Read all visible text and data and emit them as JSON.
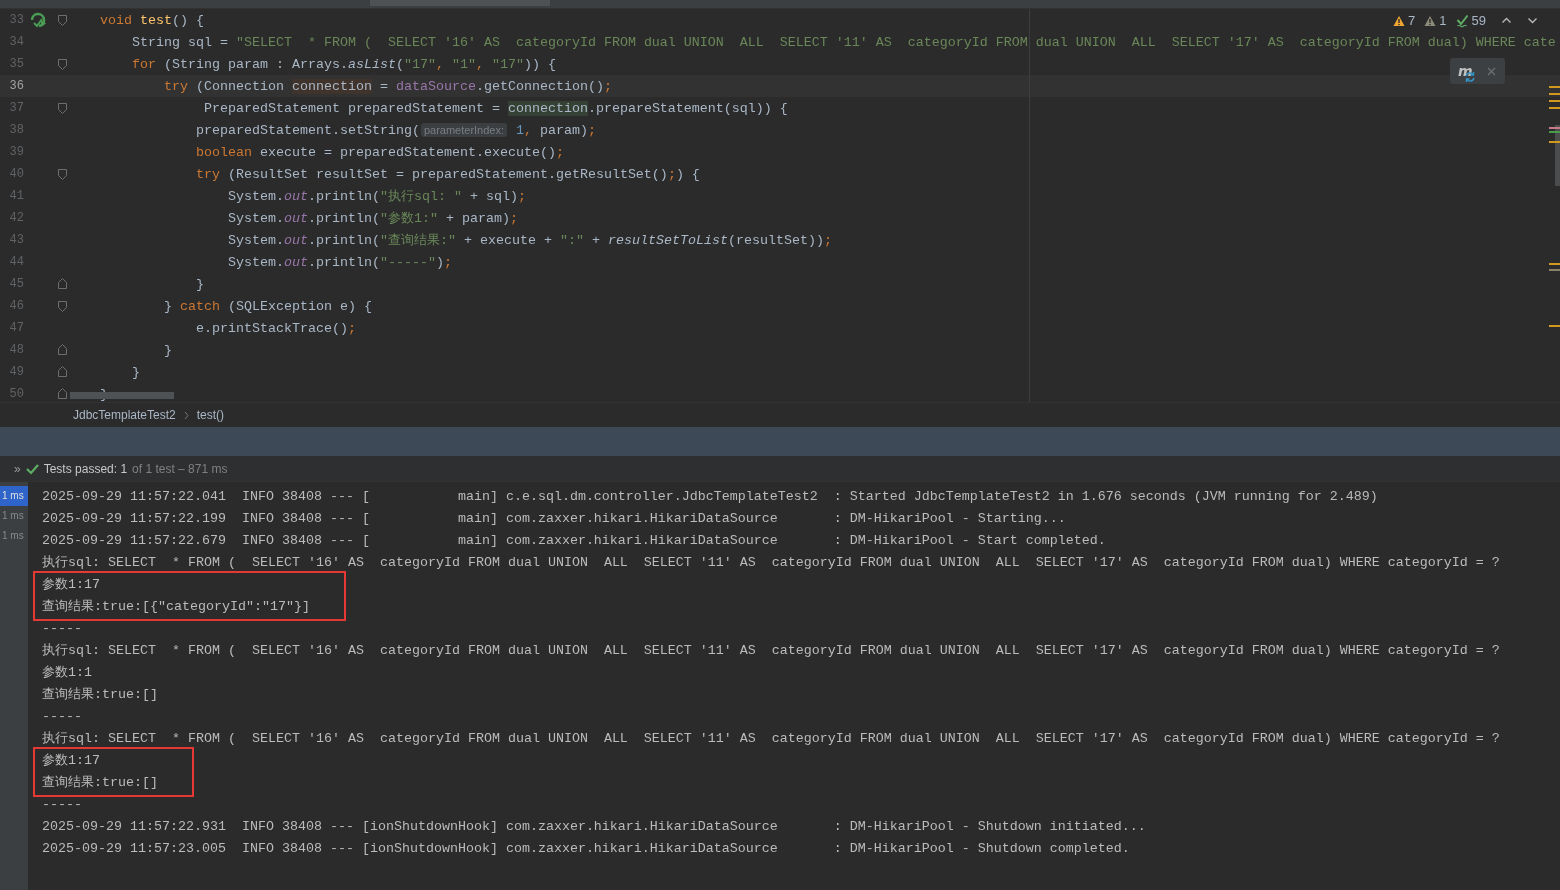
{
  "editor": {
    "inspections": [
      {
        "kind": "warning",
        "count": "7"
      },
      {
        "kind": "weak",
        "count": "1"
      },
      {
        "kind": "typo",
        "count": "59"
      }
    ],
    "popup": {
      "label": "m"
    },
    "lines": [
      {
        "number": "33",
        "current": false,
        "run": true,
        "fold_open": true,
        "fold_close": false,
        "tokens": [
          {
            "t": "    void",
            "kind": "kw"
          },
          {
            "t": " test",
            "kind": "fn"
          },
          {
            "t": "() {"
          }
        ]
      },
      {
        "number": "34",
        "current": false,
        "run": false,
        "fold_open": false,
        "fold_close": false,
        "tokens": [
          {
            "t": "        String sql = "
          },
          {
            "t": "\"SELECT  * FROM (  SELECT '16' AS  categoryId FROM dual UNION  ALL  SELECT '11' AS  categoryId FROM dual UNION  ALL  SELECT '17' AS  categoryId FROM dual) WHERE cate",
            "kind": "str"
          }
        ]
      },
      {
        "number": "35",
        "current": false,
        "run": false,
        "fold_open": true,
        "fold_close": false,
        "tokens": [
          {
            "t": "        for",
            "kind": "kw"
          },
          {
            "t": " (String param : Arrays."
          },
          {
            "t": "asList",
            "kind": "it"
          },
          {
            "t": "("
          },
          {
            "t": "\"17\"",
            "kind": "str"
          },
          {
            "t": ", ",
            "kind": "punct"
          },
          {
            "t": "\"1\"",
            "kind": "str"
          },
          {
            "t": ", ",
            "kind": "punct"
          },
          {
            "t": "\"17\"",
            "kind": "str"
          },
          {
            "t": ")) {"
          }
        ]
      },
      {
        "number": "36",
        "current": true,
        "run": false,
        "fold_open": false,
        "fold_close": false,
        "tokens": [
          {
            "t": "            try",
            "kind": "kw"
          },
          {
            "t": " (Connection "
          },
          {
            "t": "connection",
            "kind": "write"
          },
          {
            "t": " = "
          },
          {
            "t": "dataSource",
            "kind": "fld"
          },
          {
            "t": ".getConnection()"
          },
          {
            "t": ";",
            "kind": "punct"
          }
        ]
      },
      {
        "number": "37",
        "current": false,
        "run": false,
        "fold_open": true,
        "fold_close": false,
        "tokens": [
          {
            "t": "                 PreparedStatement preparedStatement = "
          },
          {
            "t": "connection",
            "kind": "read"
          },
          {
            "t": ".prepareStatement(sql)) {"
          }
        ]
      },
      {
        "number": "38",
        "current": false,
        "run": false,
        "fold_open": false,
        "fold_close": false,
        "tokens": [
          {
            "t": "                preparedStatement.setString("
          },
          {
            "t": "parameterIndex:",
            "kind": "hint"
          },
          {
            "t": " 1",
            "kind": "num"
          },
          {
            "t": ", ",
            "kind": "punct"
          },
          {
            "t": "param)"
          },
          {
            "t": ";",
            "kind": "punct"
          }
        ]
      },
      {
        "number": "39",
        "current": false,
        "run": false,
        "fold_open": false,
        "fold_close": false,
        "tokens": [
          {
            "t": "                boolean",
            "kind": "kw"
          },
          {
            "t": " execute = preparedStatement.execute()"
          },
          {
            "t": ";",
            "kind": "punct"
          }
        ]
      },
      {
        "number": "40",
        "current": false,
        "run": false,
        "fold_open": true,
        "fold_close": false,
        "tokens": [
          {
            "t": "                try",
            "kind": "kw"
          },
          {
            "t": " (ResultSet resultSet = preparedStatement.getResultSet()"
          },
          {
            "t": ";",
            "kind": "punct"
          },
          {
            "t": ") {"
          }
        ]
      },
      {
        "number": "41",
        "current": false,
        "run": false,
        "fold_open": false,
        "fold_close": false,
        "tokens": [
          {
            "t": "                    System."
          },
          {
            "t": "out",
            "kind": "sfld"
          },
          {
            "t": ".println("
          },
          {
            "t": "\"执行sql: \"",
            "kind": "str"
          },
          {
            "t": " + sql)"
          },
          {
            "t": ";",
            "kind": "punct"
          }
        ]
      },
      {
        "number": "42",
        "current": false,
        "run": false,
        "fold_open": false,
        "fold_close": false,
        "tokens": [
          {
            "t": "                    System."
          },
          {
            "t": "out",
            "kind": "sfld"
          },
          {
            "t": ".println("
          },
          {
            "t": "\"参数1:\"",
            "kind": "str"
          },
          {
            "t": " + param)"
          },
          {
            "t": ";",
            "kind": "punct"
          }
        ]
      },
      {
        "number": "43",
        "current": false,
        "run": false,
        "fold_open": false,
        "fold_close": false,
        "tokens": [
          {
            "t": "                    System."
          },
          {
            "t": "out",
            "kind": "sfld"
          },
          {
            "t": ".println("
          },
          {
            "t": "\"查询结果:\"",
            "kind": "str"
          },
          {
            "t": " + execute + "
          },
          {
            "t": "\":\"",
            "kind": "str"
          },
          {
            "t": " + "
          },
          {
            "t": "resultSetToList",
            "kind": "it"
          },
          {
            "t": "(resultSet))"
          },
          {
            "t": ";",
            "kind": "punct"
          }
        ]
      },
      {
        "number": "44",
        "current": false,
        "run": false,
        "fold_open": false,
        "fold_close": false,
        "tokens": [
          {
            "t": "                    System."
          },
          {
            "t": "out",
            "kind": "sfld"
          },
          {
            "t": ".println("
          },
          {
            "t": "\"-----\"",
            "kind": "str"
          },
          {
            "t": ")"
          },
          {
            "t": ";",
            "kind": "punct"
          }
        ]
      },
      {
        "number": "45",
        "current": false,
        "run": false,
        "fold_open": false,
        "fold_close": true,
        "tokens": [
          {
            "t": "                }"
          }
        ]
      },
      {
        "number": "46",
        "current": false,
        "run": false,
        "fold_open": true,
        "fold_close": false,
        "tokens": [
          {
            "t": "            } "
          },
          {
            "t": "catch",
            "kind": "kw"
          },
          {
            "t": " (SQLException e) {"
          }
        ]
      },
      {
        "number": "47",
        "current": false,
        "run": false,
        "fold_open": false,
        "fold_close": false,
        "tokens": [
          {
            "t": "                e.printStackTrace()"
          },
          {
            "t": ";",
            "kind": "punct"
          }
        ]
      },
      {
        "number": "48",
        "current": false,
        "run": false,
        "fold_open": false,
        "fold_close": true,
        "tokens": [
          {
            "t": "            }"
          }
        ]
      },
      {
        "number": "49",
        "current": false,
        "run": false,
        "fold_open": false,
        "fold_close": true,
        "tokens": [
          {
            "t": "        }"
          }
        ]
      },
      {
        "number": "50",
        "current": false,
        "run": false,
        "fold_open": false,
        "fold_close": true,
        "tokens": [
          {
            "t": "    }"
          }
        ]
      }
    ]
  },
  "breadcrumbs": [
    "JdbcTemplateTest2",
    "test()"
  ],
  "test_header": {
    "expand": "»",
    "status": "Tests passed: 1",
    "detail": "of 1 test – 871 ms"
  },
  "test_tree": [
    {
      "label": "1 ms",
      "selected": true
    },
    {
      "label": "1 ms",
      "selected": false
    },
    {
      "label": "1 ms",
      "selected": false
    }
  ],
  "console": [
    {
      "text": "2025-09-29 11:57:22.041  INFO 38408 --- [           main] c.e.sql.dm.controller.JdbcTemplateTest2  : Started JdbcTemplateTest2 in 1.676 seconds (JVM running for 2.489)",
      "boxed": false
    },
    {
      "text": "2025-09-29 11:57:22.199  INFO 38408 --- [           main] com.zaxxer.hikari.HikariDataSource       : DM-HikariPool - Starting...",
      "boxed": false
    },
    {
      "text": "2025-09-29 11:57:22.679  INFO 38408 --- [           main] com.zaxxer.hikari.HikariDataSource       : DM-HikariPool - Start completed.",
      "boxed": false
    },
    {
      "text": "执行sql: SELECT  * FROM (  SELECT '16' AS  categoryId FROM dual UNION  ALL  SELECT '11' AS  categoryId FROM dual UNION  ALL  SELECT '17' AS  categoryId FROM dual) WHERE categoryId = ?",
      "boxed": false
    },
    {
      "text": "参数1:17",
      "boxed": true
    },
    {
      "text": "查询结果:true:[{\"categoryId\":\"17\"}]",
      "boxed": true
    },
    {
      "text": "-----",
      "boxed": false
    },
    {
      "text": "执行sql: SELECT  * FROM (  SELECT '16' AS  categoryId FROM dual UNION  ALL  SELECT '11' AS  categoryId FROM dual UNION  ALL  SELECT '17' AS  categoryId FROM dual) WHERE categoryId = ?",
      "boxed": false
    },
    {
      "text": "参数1:1",
      "boxed": false
    },
    {
      "text": "查询结果:true:[]",
      "boxed": false
    },
    {
      "text": "-----",
      "boxed": false
    },
    {
      "text": "执行sql: SELECT  * FROM (  SELECT '16' AS  categoryId FROM dual UNION  ALL  SELECT '11' AS  categoryId FROM dual UNION  ALL  SELECT '17' AS  categoryId FROM dual) WHERE categoryId = ?",
      "boxed": false
    },
    {
      "text": "参数1:17",
      "boxed": true
    },
    {
      "text": "查询结果:true:[]",
      "boxed": true
    },
    {
      "text": "-----",
      "boxed": false
    },
    {
      "text": "2025-09-29 11:57:22.931  INFO 38408 --- [ionShutdownHook] com.zaxxer.hikari.HikariDataSource       : DM-HikariPool - Shutdown initiated...",
      "boxed": false
    },
    {
      "text": "2025-09-29 11:57:23.005  INFO 38408 --- [ionShutdownHook] com.zaxxer.hikari.HikariDataSource       : DM-HikariPool - Shutdown completed.",
      "boxed": false
    }
  ]
}
